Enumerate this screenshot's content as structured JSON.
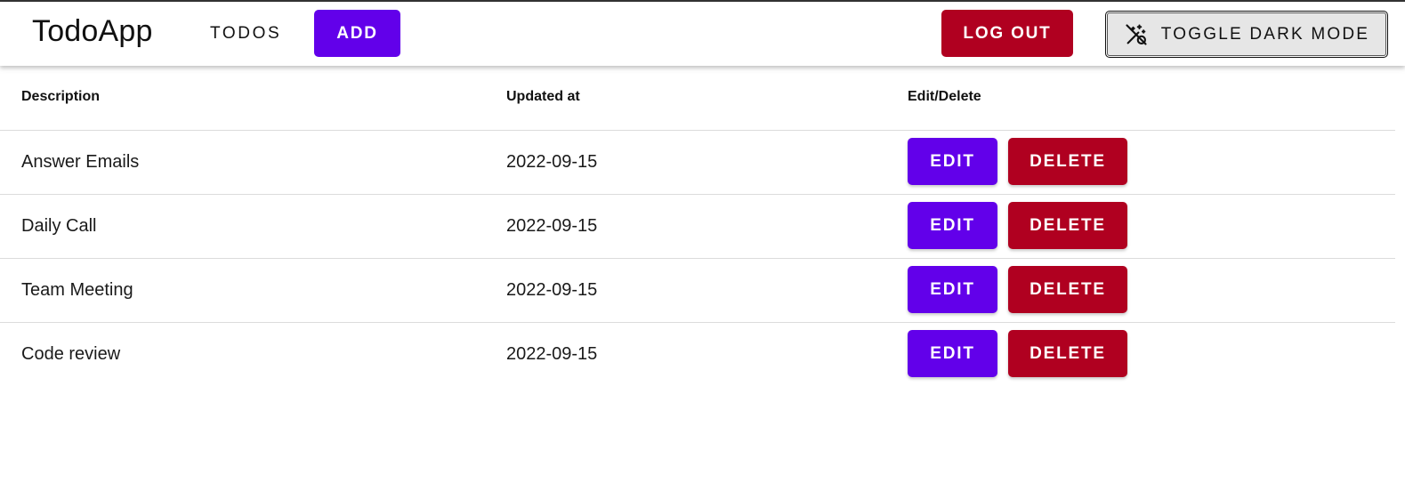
{
  "appbar": {
    "title": "TodoApp",
    "nav_todos": "TODOS",
    "add_label": "ADD",
    "logout_label": "LOG OUT",
    "dark_mode_label": "TOGGLE DARK MODE",
    "dark_mode_icon": "dark-mode-wand-icon"
  },
  "table": {
    "headers": {
      "description": "Description",
      "updated_at": "Updated at",
      "actions": "Edit/Delete"
    },
    "edit_label": "EDIT",
    "delete_label": "DELETE",
    "rows": [
      {
        "description": "Answer Emails",
        "updated_at": "2022-09-15"
      },
      {
        "description": "Daily Call",
        "updated_at": "2022-09-15"
      },
      {
        "description": "Team Meeting",
        "updated_at": "2022-09-15"
      },
      {
        "description": "Code review",
        "updated_at": "2022-09-15"
      }
    ]
  },
  "colors": {
    "primary": "#6200ea",
    "danger": "#b00020",
    "toggle_bg": "#e6e6e6"
  }
}
